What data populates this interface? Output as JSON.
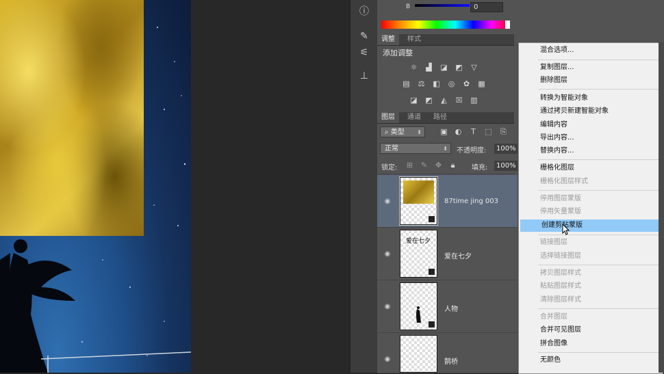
{
  "color_panel": {
    "channel_label": "B",
    "channel_value": "0"
  },
  "adjustments_panel": {
    "tabs": [
      {
        "label": "调整"
      },
      {
        "label": "样式"
      }
    ],
    "title": "添加调整"
  },
  "layers_panel": {
    "tabs": [
      {
        "label": "图层"
      },
      {
        "label": "通道"
      },
      {
        "label": "路径"
      }
    ],
    "filter_kind": "类型",
    "blend_mode": "正常",
    "opacity_label": "不透明度:",
    "opacity_value": "100%",
    "lock_label": "锁定:",
    "fill_label": "填充:",
    "fill_value": "100%",
    "layers": [
      {
        "name": "87time jing 003",
        "selected": true
      },
      {
        "name": "爱在七夕",
        "selected": false
      },
      {
        "name": "人物",
        "selected": false
      },
      {
        "name": "鹊桥",
        "selected": false
      }
    ],
    "thumb_text": "爱在七夕"
  },
  "context_menu": {
    "items": [
      {
        "label": "混合选项...",
        "disabled": false
      },
      {
        "label": "复制图层...",
        "disabled": false
      },
      {
        "label": "删除图层",
        "disabled": false
      },
      {
        "label": "转换为智能对象",
        "disabled": false
      },
      {
        "label": "通过拷贝新建智能对象",
        "disabled": false
      },
      {
        "label": "编辑内容",
        "disabled": false
      },
      {
        "label": "导出内容...",
        "disabled": false
      },
      {
        "label": "替换内容...",
        "disabled": false
      },
      {
        "label": "栅格化图层",
        "disabled": false
      },
      {
        "label": "栅格化图层样式",
        "disabled": true
      },
      {
        "label": "停用图层蒙版",
        "disabled": true
      },
      {
        "label": "停用矢量蒙版",
        "disabled": true
      },
      {
        "label": "创建剪贴蒙版",
        "disabled": false,
        "highlighted": true
      },
      {
        "label": "链接图层",
        "disabled": true
      },
      {
        "label": "选择链接图层",
        "disabled": true
      },
      {
        "label": "拷贝图层样式",
        "disabled": true
      },
      {
        "label": "粘贴图层样式",
        "disabled": true
      },
      {
        "label": "清除图层样式",
        "disabled": true
      },
      {
        "label": "合并图层",
        "disabled": true
      },
      {
        "label": "合并可见图层",
        "disabled": false
      },
      {
        "label": "拼合图像",
        "disabled": false
      },
      {
        "label": "无颜色",
        "disabled": false
      }
    ]
  },
  "colors": {
    "menu_highlight": "#91c9f7",
    "selected_layer": "#5d6a7c",
    "panel_bg": "#535353"
  }
}
